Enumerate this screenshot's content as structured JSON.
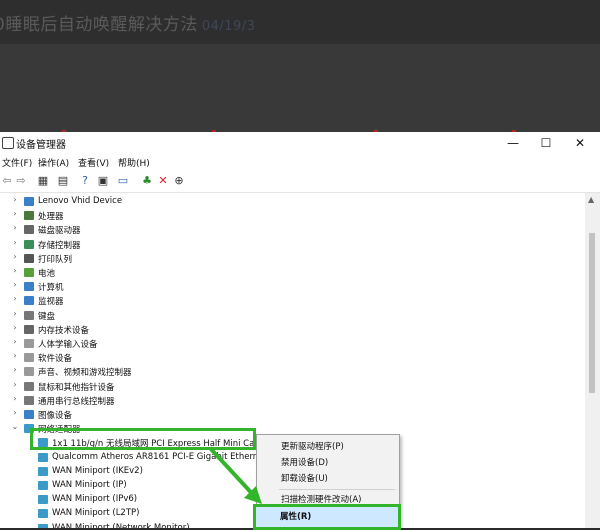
{
  "page": {
    "title_fragment": "0睡眠后自动唤醒解决方法",
    "title_suffix": "04/19/3"
  },
  "window": {
    "title": "设备管理器",
    "minimize": "—",
    "maximize": "☐",
    "close": "✕"
  },
  "menu": [
    {
      "label": "文件(F)"
    },
    {
      "label": "操作(A)"
    },
    {
      "label": "查看(V)"
    },
    {
      "label": "帮助(H)"
    }
  ],
  "toolbar": {
    "icons": [
      "back-icon",
      "forward-icon",
      "properties-grid-icon",
      "update-driver-icon",
      "help-icon",
      "view-icon",
      "monitor-icon",
      "add-device-icon",
      "remove-icon",
      "download-icon"
    ]
  },
  "tree": [
    {
      "label": "Lenovo Vhid Device",
      "expand": "›",
      "icon_color": "#3a7fc8"
    },
    {
      "label": "处理器",
      "expand": "›",
      "icon_color": "#4a7a3a"
    },
    {
      "label": "磁盘驱动器",
      "expand": "›",
      "icon_color": "#666666"
    },
    {
      "label": "存储控制器",
      "expand": "›",
      "icon_color": "#3a8e5a"
    },
    {
      "label": "打印队列",
      "expand": "›",
      "icon_color": "#555555"
    },
    {
      "label": "电池",
      "expand": "›",
      "icon_color": "#5aa03a"
    },
    {
      "label": "计算机",
      "expand": "›",
      "icon_color": "#3a7fc8"
    },
    {
      "label": "监视器",
      "expand": "›",
      "icon_color": "#3a7fc8"
    },
    {
      "label": "键盘",
      "expand": "›",
      "icon_color": "#777777"
    },
    {
      "label": "内存技术设备",
      "expand": "›",
      "icon_color": "#666666"
    },
    {
      "label": "人体学输入设备",
      "expand": "›",
      "icon_color": "#999999"
    },
    {
      "label": "软件设备",
      "expand": "›",
      "icon_color": "#999999"
    },
    {
      "label": "声音、视频和游戏控制器",
      "expand": "›",
      "icon_color": "#999999"
    },
    {
      "label": "鼠标和其他指针设备",
      "expand": "›",
      "icon_color": "#777777"
    },
    {
      "label": "通用串行总线控制器",
      "expand": "›",
      "icon_color": "#777777"
    },
    {
      "label": "图像设备",
      "expand": "›",
      "icon_color": "#3a7fc8"
    },
    {
      "label": "网络适配器",
      "expand": "⌄",
      "icon_color": "#3a9bc8"
    },
    {
      "label": "1x1 11b/g/n 无线局域网 PCI Express Half Mini Car",
      "expand": "",
      "icon_color": "#3a9bc8"
    },
    {
      "label": "Qualcomm Atheros AR8161 PCI-E Gigabit Etherne",
      "expand": "",
      "icon_color": "#3a9bc8"
    },
    {
      "label": "WAN Miniport (IKEv2)",
      "expand": "",
      "icon_color": "#3a9bc8"
    },
    {
      "label": "WAN Miniport (IP)",
      "expand": "",
      "icon_color": "#3a9bc8"
    },
    {
      "label": "WAN Miniport (IPv6)",
      "expand": "",
      "icon_color": "#3a9bc8"
    },
    {
      "label": "WAN Miniport (L2TP)",
      "expand": "",
      "icon_color": "#3a9bc8"
    },
    {
      "label": "WAN Miniport (Network Monitor)",
      "expand": "",
      "icon_color": "#3a9bc8"
    }
  ],
  "context_menu": {
    "items": [
      {
        "label": "更新驱动程序(P)"
      },
      {
        "label": "禁用设备(D)"
      },
      {
        "label": "卸载设备(U)"
      },
      {
        "label": "扫描检测硬件改动(A)"
      },
      {
        "label": "属性(R)"
      }
    ]
  },
  "colors": {
    "highlight_border": "#33b52b",
    "selection_fill": "#cde8ff"
  }
}
